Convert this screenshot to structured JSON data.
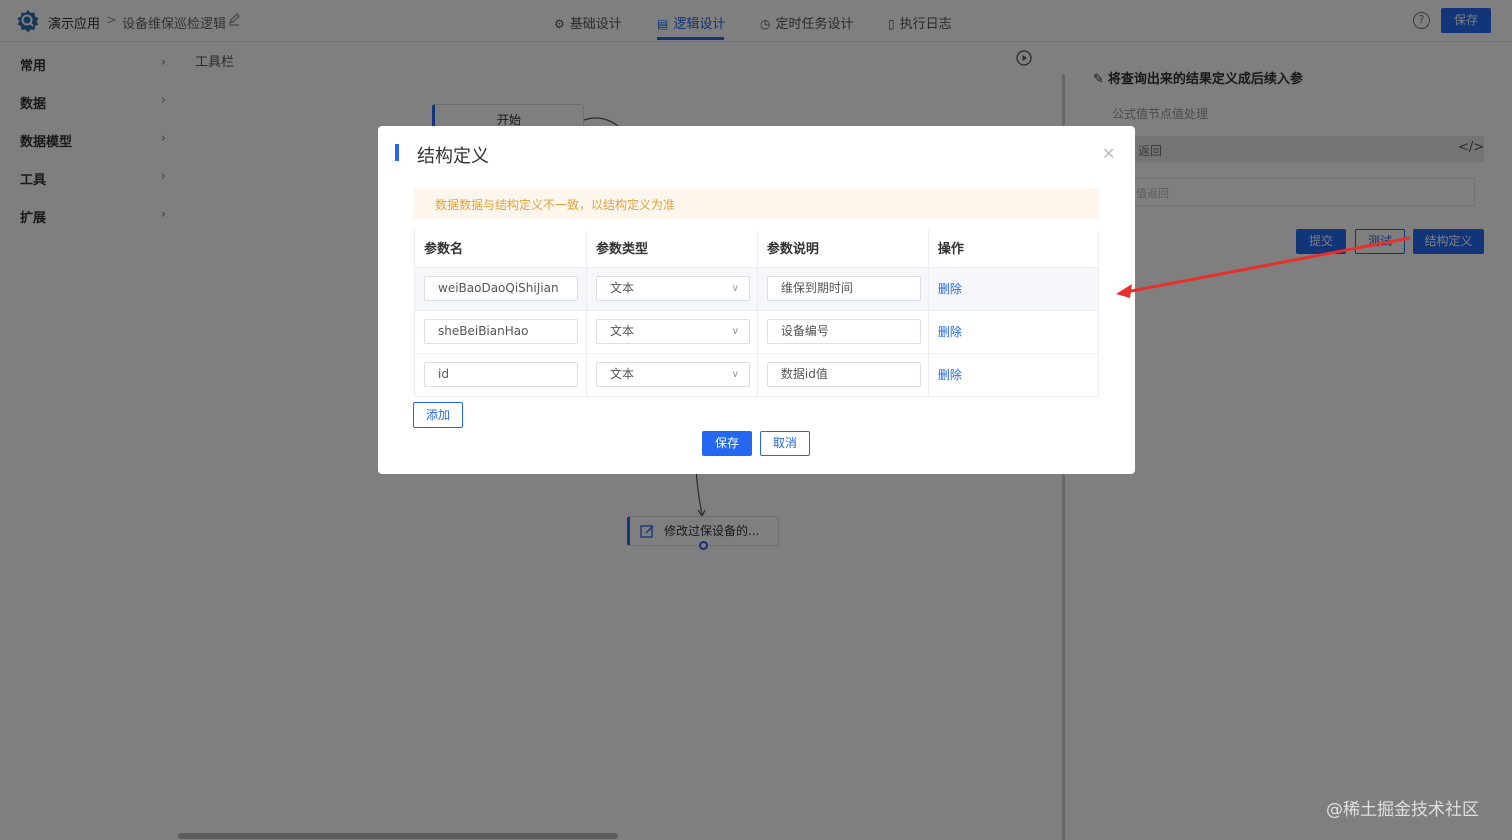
{
  "header": {
    "app_name": "演示应用",
    "separator": ">",
    "page_name": "设备维保巡检逻辑",
    "tabs": [
      {
        "label": "基础设计",
        "icon": "gear-icon"
      },
      {
        "label": "逻辑设计",
        "icon": "document-icon",
        "active": true
      },
      {
        "label": "定时任务设计",
        "icon": "clock-icon"
      },
      {
        "label": "执行日志",
        "icon": "file-icon"
      }
    ],
    "help": "?",
    "save_label": "保存",
    "accent_color": "#2468f2"
  },
  "sidebar": {
    "items": [
      {
        "label": "常用"
      },
      {
        "label": "数据"
      },
      {
        "label": "数据模型"
      },
      {
        "label": "工具"
      },
      {
        "label": "扩展"
      }
    ]
  },
  "canvas": {
    "toolbar_label": "工具栏",
    "start_node": "开始",
    "modify_node": "修改过保设备的..."
  },
  "right_panel": {
    "title": "将查询出来的结果定义成后续入参",
    "subtitle": "公式值节点值处理",
    "bar_label": "返回",
    "input_placeholder": "值返回",
    "submit_label": "提交",
    "test_label": "测试",
    "struct_label": "结构定义"
  },
  "modal": {
    "title": "结构定义",
    "alert": "数据数据与结构定义不一致，以结构定义为准",
    "columns": [
      "参数名",
      "参数类型",
      "参数说明",
      "操作"
    ],
    "rows": [
      {
        "name": "weiBaoDaoQiShiJian",
        "type": "文本",
        "desc": "维保到期时间",
        "action": "删除"
      },
      {
        "name": "sheBeiBianHao",
        "type": "文本",
        "desc": "设备编号",
        "action": "删除"
      },
      {
        "name": "id",
        "type": "文本",
        "desc": "数据id值",
        "action": "删除"
      }
    ],
    "add_label": "添加",
    "save_label": "保存",
    "cancel_label": "取消",
    "alert_color": "#e6a23c"
  },
  "watermark": "@稀土掘金技术社区"
}
